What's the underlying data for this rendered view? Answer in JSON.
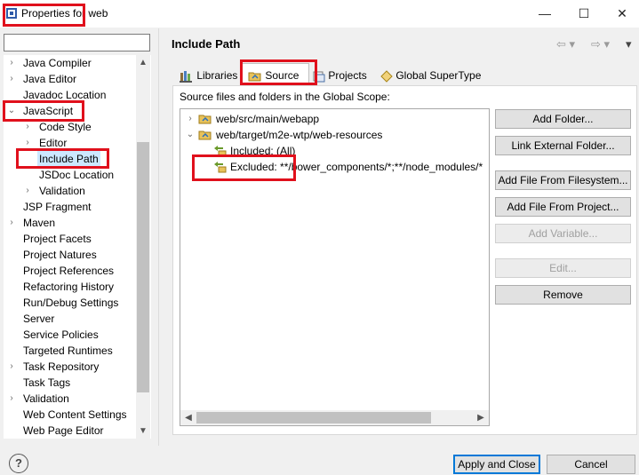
{
  "window": {
    "title": "Properties for web",
    "minimize": "—",
    "maximize": "☐",
    "close": "✕"
  },
  "filter": {
    "value": "",
    "placeholder": ""
  },
  "sidebar": {
    "items": [
      {
        "label": "Java Compiler",
        "twisty": "›",
        "indent": 0,
        "selected": false
      },
      {
        "label": "Java Editor",
        "twisty": "›",
        "indent": 0,
        "selected": false
      },
      {
        "label": "Javadoc Location",
        "twisty": "",
        "indent": 0,
        "selected": false
      },
      {
        "label": "JavaScript",
        "twisty": "⌄",
        "indent": 0,
        "selected": false
      },
      {
        "label": "Code Style",
        "twisty": "›",
        "indent": 1,
        "selected": false
      },
      {
        "label": "Editor",
        "twisty": "›",
        "indent": 1,
        "selected": false
      },
      {
        "label": "Include Path",
        "twisty": "",
        "indent": 1,
        "selected": true
      },
      {
        "label": "JSDoc Location",
        "twisty": "",
        "indent": 1,
        "selected": false
      },
      {
        "label": "Validation",
        "twisty": "›",
        "indent": 1,
        "selected": false
      },
      {
        "label": "JSP Fragment",
        "twisty": "",
        "indent": 0,
        "selected": false
      },
      {
        "label": "Maven",
        "twisty": "›",
        "indent": 0,
        "selected": false
      },
      {
        "label": "Project Facets",
        "twisty": "",
        "indent": 0,
        "selected": false
      },
      {
        "label": "Project Natures",
        "twisty": "",
        "indent": 0,
        "selected": false
      },
      {
        "label": "Project References",
        "twisty": "",
        "indent": 0,
        "selected": false
      },
      {
        "label": "Refactoring History",
        "twisty": "",
        "indent": 0,
        "selected": false
      },
      {
        "label": "Run/Debug Settings",
        "twisty": "",
        "indent": 0,
        "selected": false
      },
      {
        "label": "Server",
        "twisty": "",
        "indent": 0,
        "selected": false
      },
      {
        "label": "Service Policies",
        "twisty": "",
        "indent": 0,
        "selected": false
      },
      {
        "label": "Targeted Runtimes",
        "twisty": "",
        "indent": 0,
        "selected": false
      },
      {
        "label": "Task Repository",
        "twisty": "›",
        "indent": 0,
        "selected": false
      },
      {
        "label": "Task Tags",
        "twisty": "",
        "indent": 0,
        "selected": false
      },
      {
        "label": "Validation",
        "twisty": "›",
        "indent": 0,
        "selected": false
      },
      {
        "label": "Web Content Settings",
        "twisty": "",
        "indent": 0,
        "selected": false
      },
      {
        "label": "Web Page Editor",
        "twisty": "",
        "indent": 0,
        "selected": false
      }
    ]
  },
  "page": {
    "title": "Include Path",
    "nav_back": "⇦ ▾",
    "nav_forward": "⇨ ▾",
    "menu": "▾"
  },
  "tabs": [
    {
      "label": "Libraries",
      "active": false
    },
    {
      "label": "Source",
      "active": true
    },
    {
      "label": "Projects",
      "active": false
    },
    {
      "label": "Global SuperType",
      "active": false
    }
  ],
  "source": {
    "scope_label": "Source files and folders in the Global Scope:",
    "tree": [
      {
        "label": "web/src/main/webapp",
        "twisty": "›",
        "kind": "folder"
      },
      {
        "label": "web/target/m2e-wtp/web-resources",
        "twisty": "⌄",
        "kind": "folder"
      },
      {
        "label": "Included: (All)",
        "twisty": "",
        "kind": "filter"
      },
      {
        "label": "Excluded: **/bower_components/*;**/node_modules/*",
        "twisty": "",
        "kind": "filter"
      }
    ]
  },
  "buttons": [
    {
      "label": "Add Folder...",
      "enabled": true
    },
    {
      "label": "Link External Folder...",
      "enabled": true
    },
    {
      "label": "Add File From Filesystem...",
      "enabled": true
    },
    {
      "label": "Add File From Project...",
      "enabled": true
    },
    {
      "label": "Add Variable...",
      "enabled": false
    },
    {
      "label": "Edit...",
      "enabled": false
    },
    {
      "label": "Remove",
      "enabled": true
    }
  ],
  "footer": {
    "help": "?",
    "apply_close": "Apply and Close",
    "cancel": "Cancel"
  },
  "colors": {
    "selection": "#cce8ff",
    "highlight": "#e0101c",
    "default_button_border": "#0078d7"
  }
}
